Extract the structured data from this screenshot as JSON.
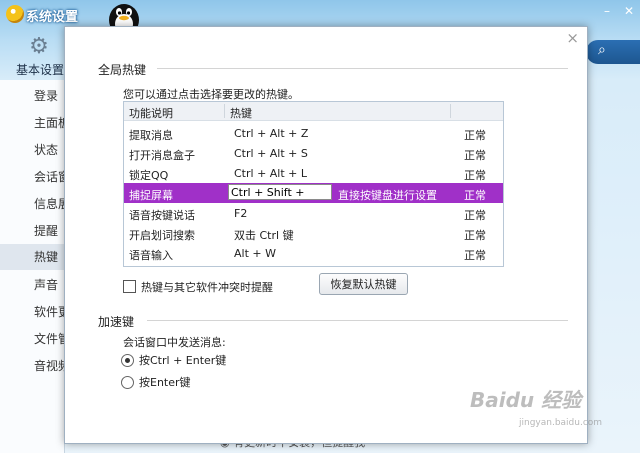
{
  "background": {
    "window_title": "系统设置",
    "basic_settings_label": "基本设置",
    "nav_items": [
      {
        "label": "登录"
      },
      {
        "label": "主面板"
      },
      {
        "label": "状态"
      },
      {
        "label": "会话窗口"
      },
      {
        "label": "信息展示"
      },
      {
        "label": "提醒"
      },
      {
        "label": "热键",
        "active": true
      },
      {
        "label": "声音"
      },
      {
        "label": "软件更新"
      },
      {
        "label": "文件管理"
      },
      {
        "label": "音视频"
      }
    ],
    "bottom_text": "◉ 有更新时不安装，但提醒我"
  },
  "dialog": {
    "global_hotkeys_title": "全局热键",
    "hint": "您可以通过点击选择要更改的热键。",
    "table": {
      "columns": [
        "功能说明",
        "热键"
      ],
      "rows": [
        {
          "func": "提取消息",
          "key": "Ctrl + Alt + Z",
          "status": "正常"
        },
        {
          "func": "打开消息盒子",
          "key": "Ctrl + Alt + S",
          "status": "正常"
        },
        {
          "func": "锁定QQ",
          "key": "Ctrl + Alt + L",
          "status": "正常"
        },
        {
          "func": "捕捉屏幕",
          "key": "Ctrl + Shift +",
          "note": "直接按键盘进行设置",
          "status": "正常",
          "selected": true
        },
        {
          "func": "语音按键说话",
          "key": "F2",
          "status": "正常"
        },
        {
          "func": "开启划词搜索",
          "key": "双击 Ctrl 键",
          "status": "正常"
        },
        {
          "func": "语音输入",
          "key": "Alt + W",
          "status": "正常"
        }
      ]
    },
    "conflict_checkbox_label": "热键与其它软件冲突时提醒",
    "conflict_checked": false,
    "restore_button": "恢复默认热键",
    "accel_title": "加速键",
    "send_label": "会话窗口中发送消息:",
    "send_options": [
      {
        "label": "按Ctrl + Enter键",
        "selected": true
      },
      {
        "label": "按Enter键",
        "selected": false
      }
    ],
    "close_glyph": "×"
  },
  "watermark": {
    "main": "Baidu 经验",
    "sub": "jingyan.baidu.com"
  },
  "colors": {
    "selected_row": "#a030c8",
    "title_bar": "#8fc6ea"
  }
}
